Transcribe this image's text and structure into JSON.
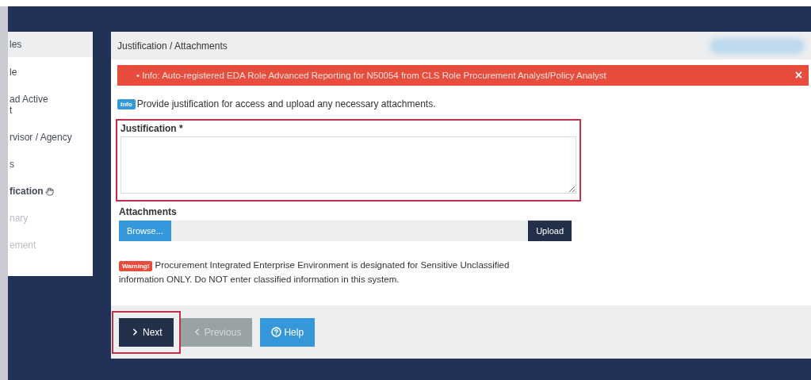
{
  "sidebar": {
    "items": [
      {
        "label": "les",
        "kind": "header",
        "current": false,
        "disabled": false
      },
      {
        "label": "le",
        "kind": "step",
        "current": false,
        "disabled": false
      },
      {
        "label": "ad Active\nt",
        "kind": "step",
        "current": false,
        "disabled": false
      },
      {
        "label": "rvisor / Agency",
        "kind": "step",
        "current": false,
        "disabled": false
      },
      {
        "label": "s",
        "kind": "step",
        "current": false,
        "disabled": false
      },
      {
        "label": "fication",
        "kind": "step",
        "current": true,
        "disabled": false
      },
      {
        "label": "nary",
        "kind": "step",
        "current": false,
        "disabled": true
      },
      {
        "label": "ement",
        "kind": "step",
        "current": false,
        "disabled": true
      }
    ]
  },
  "panel": {
    "title": "Justification / Attachments",
    "alert": {
      "bullet": "•",
      "text": "Info: Auto-registered EDA Role Advanced Reporting for N50054 from CLS Role Procurement Analyst/Policy Analyst",
      "close": "×"
    },
    "info": {
      "badge": "Info",
      "text": "Provide justification for access and upload any necessary attachments."
    },
    "justification": {
      "label": "Justification *",
      "highlighted": true
    },
    "attachments": {
      "label": "Attachments",
      "browse": "Browse...",
      "upload": "Upload"
    },
    "warning": {
      "badge": "Warning!",
      "text": "Procurement Integrated Enterprise Environment is designated for Sensitive Unclassified information ONLY. Do NOT enter classified information in this system."
    },
    "buttons": [
      {
        "label": "Next",
        "kind": "next",
        "disabled": false,
        "highlighted": true
      },
      {
        "label": "Previous",
        "kind": "previous",
        "disabled": true,
        "highlighted": false
      },
      {
        "label": "Help",
        "kind": "help",
        "disabled": false,
        "highlighted": false
      }
    ]
  }
}
